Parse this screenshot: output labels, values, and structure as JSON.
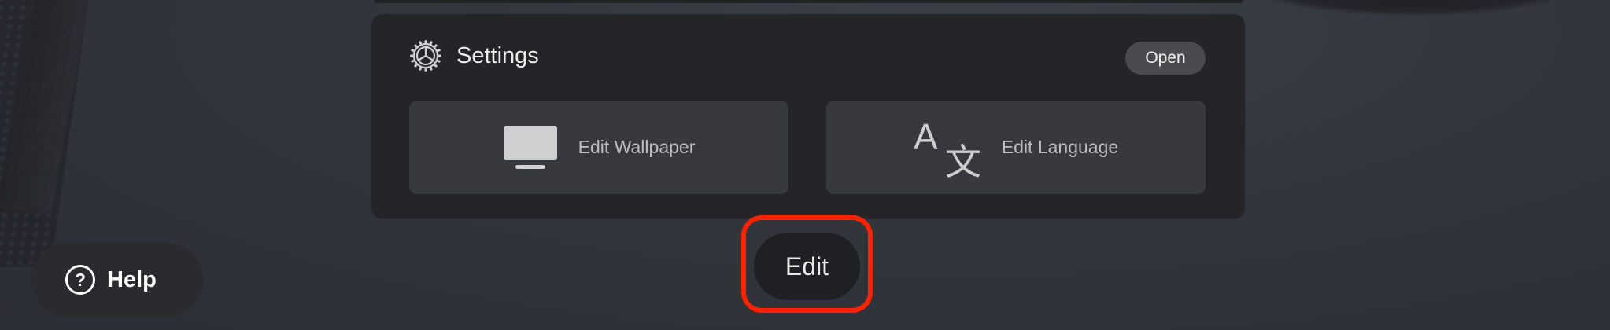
{
  "settings": {
    "title": "Settings",
    "open_label": "Open",
    "tiles": [
      {
        "label": "Edit Wallpaper",
        "icon": "monitor-icon"
      },
      {
        "label": "Edit Language",
        "icon": "translate-icon"
      }
    ]
  },
  "edit_label": "Edit",
  "help_label": "Help",
  "colors": {
    "panel_bg": "#252529",
    "tile_bg": "#38393e",
    "highlight": "#ff2200",
    "open_btn_bg": "#4a4a4f"
  }
}
